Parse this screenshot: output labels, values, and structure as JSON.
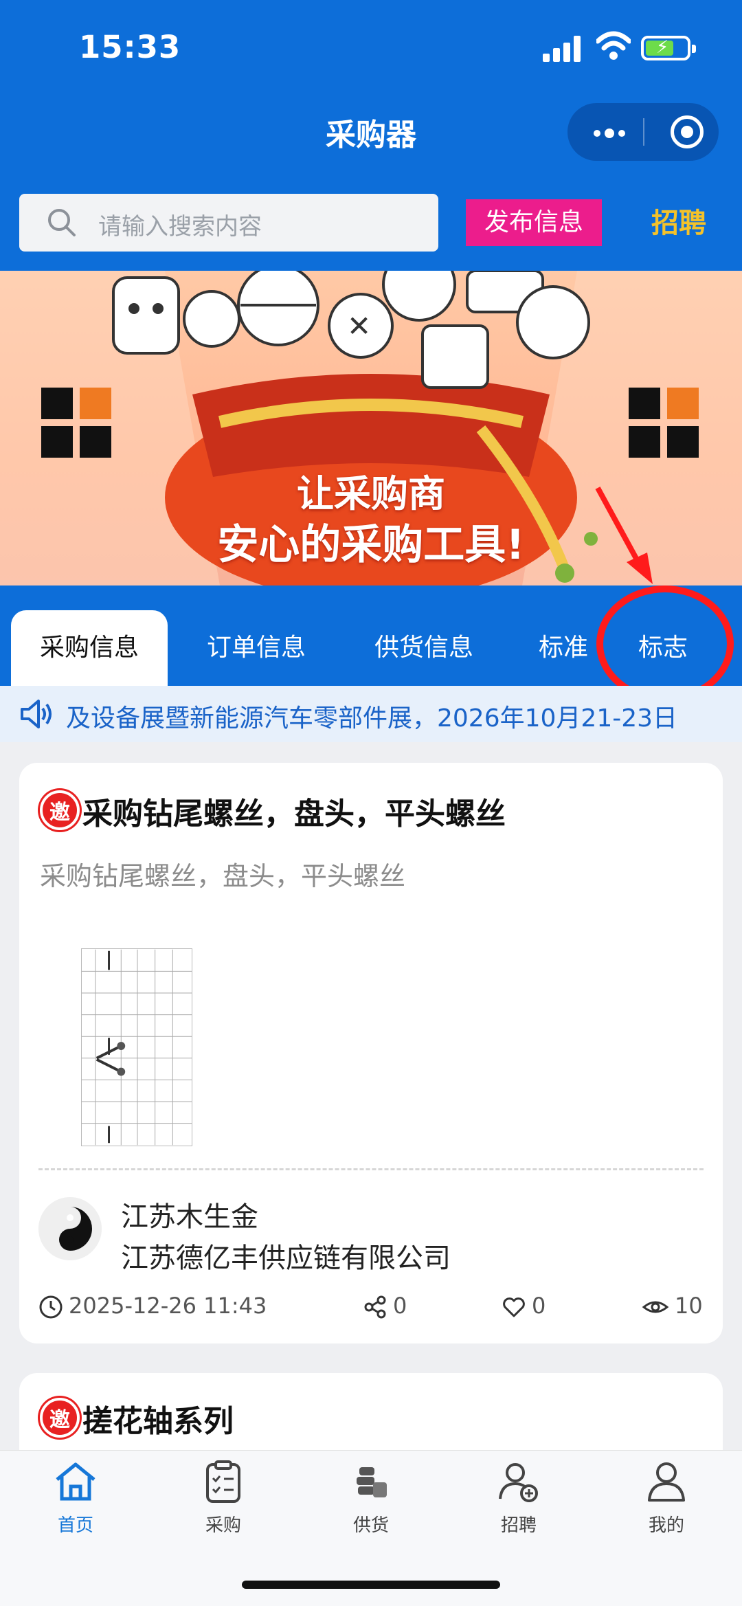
{
  "status": {
    "time": "15:33"
  },
  "header": {
    "title": "采购器"
  },
  "search": {
    "placeholder": "请输入搜索内容",
    "publish_label": "发布信息",
    "recruit_label": "招聘"
  },
  "banner": {
    "line1": "让采购商",
    "line2": "安心的采购工具!"
  },
  "tabs": [
    {
      "label": "采购信息",
      "active": true
    },
    {
      "label": "订单信息",
      "active": false
    },
    {
      "label": "供货信息",
      "active": false
    },
    {
      "label": "标准",
      "active": false
    },
    {
      "label": "标志",
      "active": false
    }
  ],
  "notice": {
    "text": "及设备展暨新能源汽车零部件展，2026年10月21-23日"
  },
  "cards": [
    {
      "badge": "邀",
      "title": "采购钻尾螺丝，盘头，平头螺丝",
      "description": "采购钻尾螺丝，盘头，平头螺丝",
      "publisher_name": "江苏木生金",
      "company": "江苏德亿丰供应链有限公司",
      "date": "2025-12-26 11:43",
      "shares": "0",
      "likes": "0",
      "views": "10"
    },
    {
      "badge": "邀",
      "title": "搓花轴系列"
    }
  ],
  "bottom_nav": [
    {
      "label": "首页",
      "icon": "home-icon",
      "active": true
    },
    {
      "label": "采购",
      "icon": "clipboard-icon",
      "active": false
    },
    {
      "label": "供货",
      "icon": "coins-icon",
      "active": false
    },
    {
      "label": "招聘",
      "icon": "add-person-icon",
      "active": false
    },
    {
      "label": "我的",
      "icon": "user-icon",
      "active": false
    }
  ],
  "colors": {
    "primary": "#0d6ed9",
    "publish": "#ec1d8c",
    "recruit": "#f4c22a",
    "annotation": "#ff1b1b",
    "badge": "#e82121"
  }
}
